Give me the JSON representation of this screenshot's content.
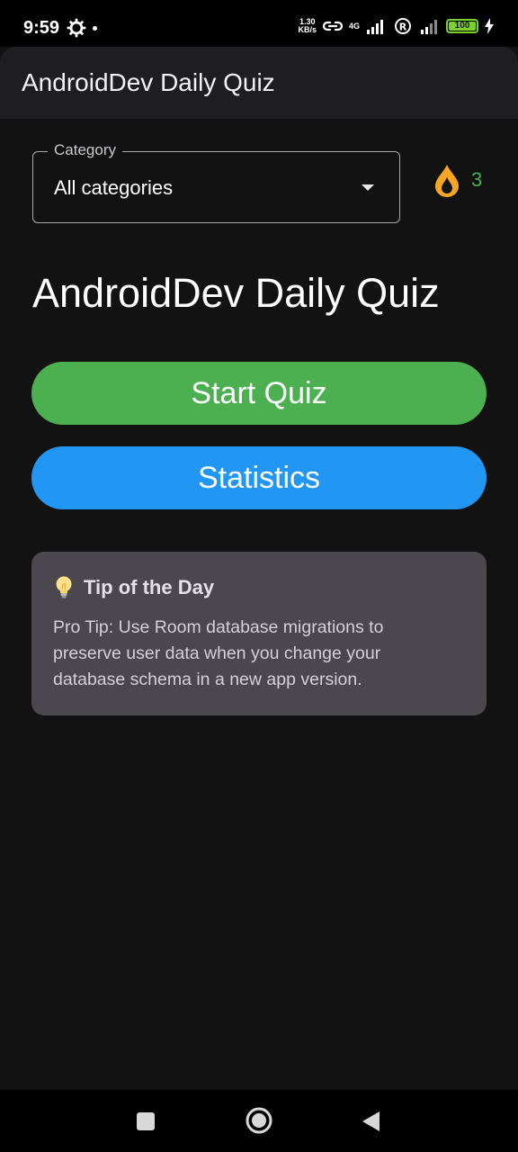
{
  "status_bar": {
    "time": "9:59",
    "speed_value": "1.30",
    "speed_unit": "KB/s",
    "network": "4G",
    "battery_level": "100",
    "battery_color": "#7bd12c"
  },
  "app_bar": {
    "title": "AndroidDev Daily Quiz"
  },
  "category": {
    "label": "Category",
    "value": "All categories"
  },
  "streak": {
    "count": "3",
    "icon": "flame-icon",
    "icon_color": "#f5a623",
    "count_color": "#4caf50"
  },
  "main": {
    "title": "AndroidDev Daily Quiz",
    "start_label": "Start Quiz",
    "start_color": "#4caf50",
    "stats_label": "Statistics",
    "stats_color": "#2196f3"
  },
  "tip": {
    "title": "Tip of the Day",
    "icon": "lightbulb-icon",
    "body": "Pro Tip: Use Room database migrations to preserve user data when you change your database schema in a new app version."
  },
  "nav": {
    "recents": "square-icon",
    "home": "circle-icon",
    "back": "triangle-back-icon"
  }
}
